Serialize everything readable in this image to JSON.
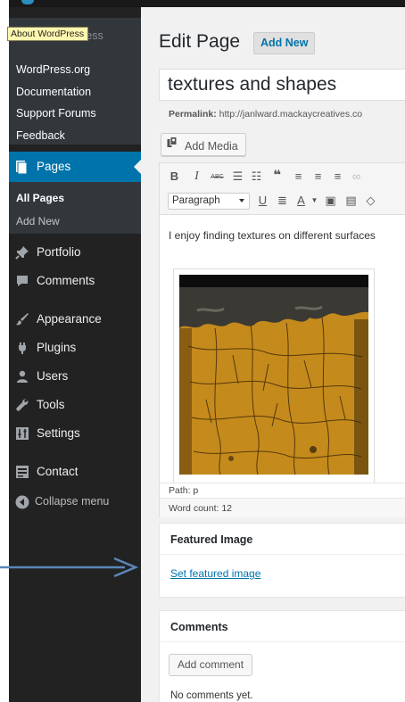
{
  "sidebar": {
    "top_submenu": {
      "faded_item": "About WordPress",
      "items": [
        "WordPress.org",
        "Documentation",
        "Support Forums",
        "Feedback"
      ]
    },
    "tooltip": "About WordPress",
    "active_menu": {
      "label": "Pages",
      "icon": "pages-icon"
    },
    "pages_submenu": [
      "All Pages",
      "Add New"
    ],
    "menu": [
      {
        "label": "Portfolio",
        "icon": "pin-icon"
      },
      {
        "label": "Comments",
        "icon": "comment-bubble-icon"
      },
      {
        "label": "Appearance",
        "icon": "paintbrush-icon"
      },
      {
        "label": "Plugins",
        "icon": "plug-icon"
      },
      {
        "label": "Users",
        "icon": "user-icon"
      },
      {
        "label": "Tools",
        "icon": "wrench-icon"
      },
      {
        "label": "Settings",
        "icon": "sliders-icon"
      },
      {
        "label": "Contact",
        "icon": "contact-form-icon"
      }
    ],
    "collapse_label": "Collapse menu",
    "colors": {
      "background": "#222222",
      "submenu": "#32373c",
      "active": "#0073aa"
    }
  },
  "header": {
    "title": "Edit Page",
    "add_new_label": "Add New"
  },
  "editor": {
    "post_title": "textures and shapes",
    "permalink_label": "Permalink:",
    "permalink_url": "http://janlward.mackaycreatives.co",
    "add_media_label": "Add Media",
    "format_select_value": "Paragraph",
    "body_text": "I enjoy finding textures on different surfaces",
    "path": "Path: p",
    "word_count": "Word count: 12"
  },
  "featured_image": {
    "heading": "Featured Image",
    "link_label": "Set featured image"
  },
  "comments_box": {
    "heading": "Comments",
    "add_comment_label": "Add comment",
    "empty_text": "No comments yet."
  },
  "colors": {
    "link": "#0073aa",
    "annotation_arrow": "#5b86b8",
    "content_bg": "#f1f1f1"
  }
}
